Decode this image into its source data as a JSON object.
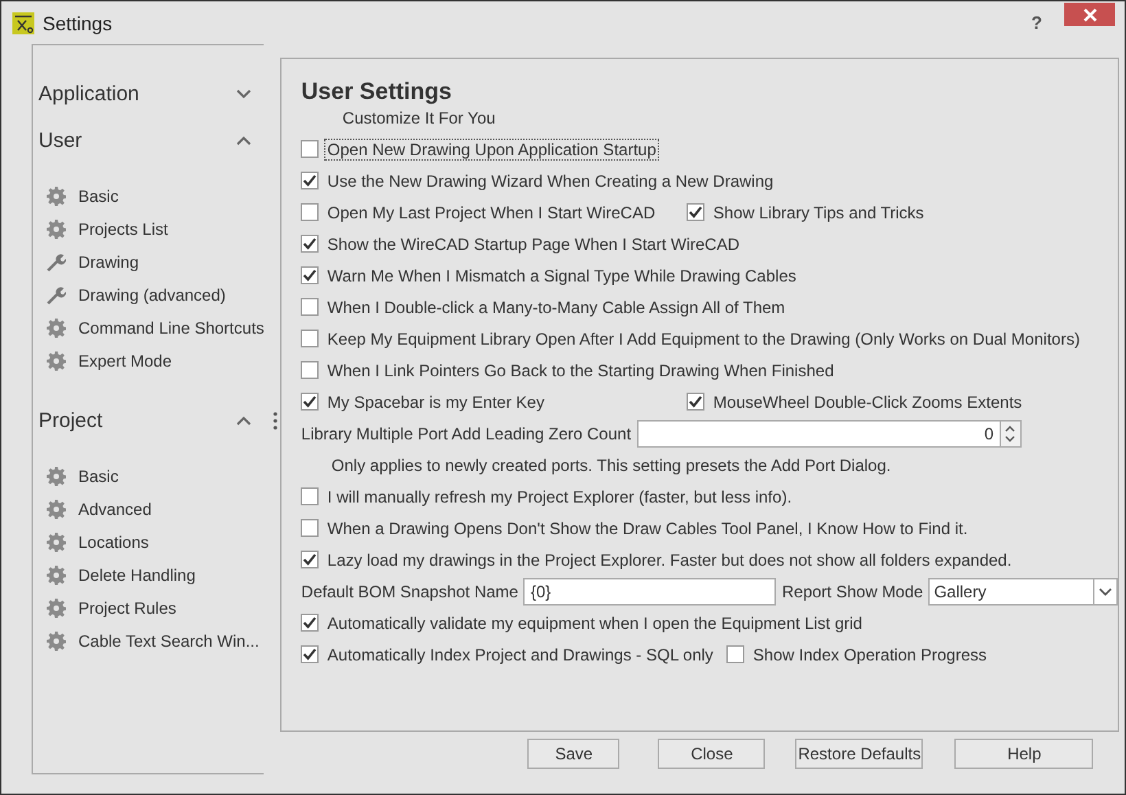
{
  "window": {
    "title": "Settings",
    "help_label": "?"
  },
  "sidebar": {
    "sections": [
      {
        "title": "Application",
        "expanded": false
      },
      {
        "title": "User",
        "expanded": true,
        "items": [
          {
            "label": "Basic"
          },
          {
            "label": "Projects List"
          },
          {
            "label": "Drawing"
          },
          {
            "label": "Drawing (advanced)"
          },
          {
            "label": "Command Line Shortcuts"
          },
          {
            "label": "Expert Mode"
          }
        ]
      },
      {
        "title": "Project",
        "expanded": true,
        "items": [
          {
            "label": "Basic"
          },
          {
            "label": "Advanced"
          },
          {
            "label": "Locations"
          },
          {
            "label": "Delete Handling"
          },
          {
            "label": "Project Rules"
          },
          {
            "label": "Cable Text Search Win..."
          }
        ]
      }
    ]
  },
  "panel": {
    "title": "User Settings",
    "subtitle": "Customize It For You",
    "rows": [
      [
        {
          "kind": "checkbox",
          "label": "Open New Drawing Upon Application Startup",
          "checked": false,
          "focused": true
        }
      ],
      [
        {
          "kind": "checkbox",
          "label": "Use the New Drawing Wizard When Creating a New Drawing",
          "checked": true,
          "focused": false
        }
      ],
      [
        {
          "kind": "checkbox",
          "label": "Open My Last Project When I Start WireCAD",
          "checked": false,
          "focused": false
        },
        {
          "kind": "checkbox",
          "label": "Show Library Tips and Tricks",
          "checked": true,
          "focused": false
        }
      ],
      [
        {
          "kind": "checkbox",
          "label": "Show the WireCAD Startup Page When I Start WireCAD",
          "checked": true,
          "focused": false
        }
      ],
      [
        {
          "kind": "checkbox",
          "label": "Warn Me When I Mismatch a Signal Type While Drawing Cables",
          "checked": true,
          "focused": false
        }
      ],
      [
        {
          "kind": "checkbox",
          "label": "When I Double-click a Many-to-Many Cable Assign All of Them",
          "checked": false,
          "focused": false
        }
      ],
      [
        {
          "kind": "checkbox",
          "label": "Keep My Equipment Library Open After I Add Equipment to the Drawing (Only Works on Dual Monitors)",
          "checked": false,
          "focused": false
        }
      ],
      [
        {
          "kind": "checkbox",
          "label": "When I Link Pointers Go Back to the Starting Drawing When Finished",
          "checked": false,
          "focused": false
        }
      ],
      [
        {
          "kind": "checkbox",
          "label": "My Spacebar is my Enter Key",
          "checked": true,
          "focused": false
        },
        {
          "kind": "checkbox",
          "label": "MouseWheel Double-Click Zooms Extents",
          "checked": true,
          "focused": false
        }
      ],
      [
        {
          "kind": "number",
          "label": "Library Multiple Port Add Leading Zero Count",
          "value": "0"
        }
      ],
      [
        {
          "kind": "note",
          "label": "Only applies to newly created ports. This setting presets the Add Port Dialog."
        }
      ],
      [
        {
          "kind": "checkbox",
          "label": "I will manually refresh my Project Explorer (faster, but less info).",
          "checked": false,
          "focused": false
        }
      ],
      [
        {
          "kind": "checkbox",
          "label": "When a Drawing Opens Don't Show the Draw Cables Tool Panel, I Know How to Find it.",
          "checked": false,
          "focused": false
        }
      ],
      [
        {
          "kind": "checkbox",
          "label": "Lazy load my drawings in the Project Explorer. Faster but does not show all folders expanded.",
          "checked": true,
          "focused": false
        }
      ],
      [
        {
          "kind": "text",
          "label": "Default BOM Snapshot Name",
          "value": "{0}"
        },
        {
          "kind": "select",
          "label": "Report Show Mode",
          "value": "Gallery"
        }
      ],
      [
        {
          "kind": "checkbox",
          "label": "Automatically validate my equipment when I open the Equipment List grid",
          "checked": true,
          "focused": false
        }
      ],
      [
        {
          "kind": "checkbox",
          "label": "Automatically Index Project and Drawings - SQL only",
          "checked": true,
          "focused": false
        },
        {
          "kind": "checkbox",
          "label": "Show Index Operation Progress",
          "checked": false,
          "focused": false
        }
      ]
    ]
  },
  "buttons": [
    "Save",
    "Close",
    "Restore Defaults",
    "Help"
  ]
}
